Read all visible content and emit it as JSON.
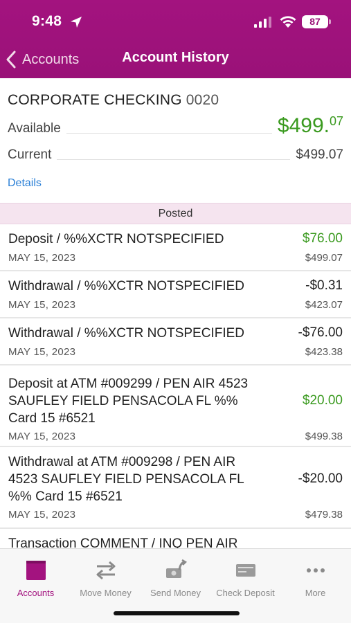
{
  "status_bar": {
    "time": "9:48",
    "battery": "87"
  },
  "nav": {
    "back_label": "Accounts",
    "title": "Account History"
  },
  "account": {
    "name": "CORPORATE CHECKING",
    "number": "0020",
    "available_label": "Available",
    "available_dollars": "$499.",
    "available_cents": "07",
    "current_label": "Current",
    "current_value": "$499.07",
    "details_label": "Details"
  },
  "section": {
    "posted_label": "Posted"
  },
  "transactions": [
    {
      "description": "Deposit / %%XCTR NOTSPECIFIED",
      "date": "MAY 15, 2023",
      "amount": "$76.00",
      "balance": "$499.07",
      "type": "credit"
    },
    {
      "description": "Withdrawal / %%XCTR NOTSPECIFIED",
      "date": "MAY 15, 2023",
      "amount": "-$0.31",
      "balance": "$423.07",
      "type": "debit"
    },
    {
      "description": "Withdrawal / %%XCTR NOTSPECIFIED",
      "date": "MAY 15, 2023",
      "amount": "-$76.00",
      "balance": "$423.38",
      "type": "debit"
    },
    {
      "description": "Deposit at ATM #009299 / PEN AIR 4523 SAUFLEY FIELD PENSACOLA FL %% Card 15 #6521",
      "date": "MAY 15, 2023",
      "amount": "$20.00",
      "balance": "$499.38",
      "type": "credit"
    },
    {
      "description": "Withdrawal at ATM #009298 / PEN AIR 4523 SAUFLEY FIELD PENSACOLA FL %% Card 15 #6521",
      "date": "MAY 15, 2023",
      "amount": "-$20.00",
      "balance": "$479.38",
      "type": "debit"
    },
    {
      "description": "Transaction COMMENT / INQ PEN AIR",
      "date": "",
      "amount": "",
      "balance": "",
      "type": "debit"
    }
  ],
  "tabs": [
    {
      "label": "Accounts",
      "icon": "accounts-icon",
      "active": true
    },
    {
      "label": "Move Money",
      "icon": "transfer-arrows-icon",
      "active": false
    },
    {
      "label": "Send Money",
      "icon": "send-money-icon",
      "active": false
    },
    {
      "label": "Check Deposit",
      "icon": "check-deposit-icon",
      "active": false
    },
    {
      "label": "More",
      "icon": "more-dots-icon",
      "active": false
    }
  ],
  "colors": {
    "brand": "#a3137f",
    "positive": "#3a9a1f",
    "link": "#2a7fd6"
  }
}
